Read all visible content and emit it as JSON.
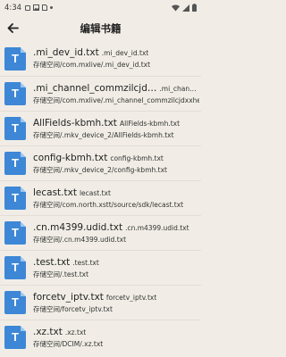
{
  "status_bar": {
    "time": "4:34",
    "icons": [
      "notification-square-icon",
      "image-icon",
      "sim-icon",
      "dot-icon"
    ],
    "right_icons": [
      "wifi-icon",
      "signal-icon",
      "battery-icon"
    ]
  },
  "toolbar": {
    "back_icon": "arrow-left-icon",
    "title": "编辑书籍"
  },
  "files": [
    {
      "name": ".mi_dev_id.txt",
      "sub": ".mi_dev_id.txt",
      "path": "存储空间/com.mxlive/.mi_dev_id.txt",
      "icon_letter": "T"
    },
    {
      "name": ".mi_channel_commzilcjd…",
      "sub": ".mi_channel_co…",
      "path": "存储空间/com.mxlive/.mi_channel_commzilcjdxxheyt…",
      "icon_letter": "T"
    },
    {
      "name": "AllFields-kbmh.txt",
      "sub": "AllFields-kbmh.txt",
      "path": "存储空间/.mkv_device_2/AllFields-kbmh.txt",
      "icon_letter": "T"
    },
    {
      "name": "config-kbmh.txt",
      "sub": "config-kbmh.txt",
      "path": "存储空间/.mkv_device_2/config-kbmh.txt",
      "icon_letter": "T"
    },
    {
      "name": "lecast.txt",
      "sub": "lecast.txt",
      "path": "存储空间/com.north.xstt/source/sdk/lecast.txt",
      "icon_letter": "T"
    },
    {
      "name": ".cn.m4399.udid.txt",
      "sub": ".cn.m4399.udid.txt",
      "path": "存储空间/.cn.m4399.udid.txt",
      "icon_letter": "T"
    },
    {
      "name": ".test.txt",
      "sub": ".test.txt",
      "path": "存储空间/.test.txt",
      "icon_letter": "T"
    },
    {
      "name": "forcetv_iptv.txt",
      "sub": "forcetv_iptv.txt",
      "path": "存储空间/forcetv_iptv.txt",
      "icon_letter": "T"
    },
    {
      "name": ".xz.txt",
      "sub": ".xz.txt",
      "path": "存储空间/DCIM/.xz.txt",
      "icon_letter": "T"
    }
  ],
  "colors": {
    "background": "#f1ede6",
    "file_icon": "#3d87d6",
    "text": "#222222"
  }
}
